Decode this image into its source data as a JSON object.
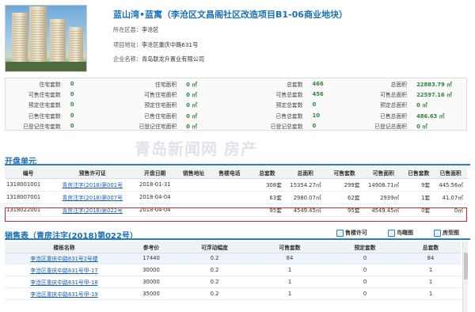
{
  "project": {
    "title": "蓝山湾•蓝寓（李沧区文昌阁社区改造项目B1-06商业地块）",
    "district_label": "所在区县：",
    "district": "李沧区",
    "address_label": "项目地址：",
    "address": "李沧区重庆中路631号",
    "company_label": "企业名称：",
    "company": "青岛联龙升置业有限公司"
  },
  "stats": [
    [
      "住宅套数",
      "0",
      "住宅面积",
      "0 ㎡",
      "总套数",
      "466",
      "总面积",
      "22883.79 ㎡"
    ],
    [
      "可售住宅套数",
      "0",
      "可售住宅面积",
      "0 ㎡",
      "可售总套数",
      "456",
      "可售总面积",
      "22597.16 ㎡"
    ],
    [
      "预定住宅套数",
      "0",
      "预定住宅面积",
      "0 ㎡",
      "预定总套数",
      "0",
      "预定总面积",
      "0 ㎡"
    ],
    [
      "已售住宅套数",
      "0",
      "已售住宅面积",
      "0 ㎡",
      "已售总套数",
      "10",
      "已售总面积",
      "486.63 ㎡"
    ],
    [
      "已登记住宅套数",
      "0",
      "已登记住宅面积",
      "0 ㎡",
      "已登记总套数",
      "0",
      "已登记总面积",
      "0 ㎡"
    ]
  ],
  "watermark": "青岛新闻网 房产",
  "units_section": {
    "title": "开盘单元",
    "headers": [
      "编号",
      "预售许可证",
      "开盘日期",
      "销售地址",
      "售楼电话",
      "总套数",
      "总面积",
      "可售套数",
      "可售面积",
      "已售套数",
      "已售面积"
    ],
    "rows": [
      [
        "1318001001",
        "青房注字(2018)第001号",
        "2018-01-31",
        "",
        "",
        "308套",
        "15354.27㎡",
        "299套",
        "14908.71㎡",
        "9套",
        "445.56㎡"
      ],
      [
        "1318007001",
        "青房注字(2018)第007号",
        "2018-04-04",
        "",
        "",
        "63套",
        "2980.07㎡",
        "62套",
        "2939㎡",
        "1套",
        "41.07㎡"
      ],
      [
        "1318022001",
        "青房注字(2018)第022号",
        "2018-04-04",
        "",
        "",
        "95套",
        "4549.45㎡",
        "95套",
        "4549.45㎡",
        "0套",
        "0㎡"
      ]
    ]
  },
  "sales_section": {
    "title": "销售表（青房注字(2018)第022号）",
    "links": [
      "售楼许可",
      "鸟瞰图",
      "房型图"
    ],
    "headers": [
      "楼栋名称",
      "参考价",
      "可浮动幅度",
      "可售套数",
      "预定套数",
      "总套数"
    ],
    "rows": [
      [
        "李沧区重庆中路631号2号楼",
        "17440",
        "0.2",
        "84",
        "0",
        "84"
      ],
      [
        "李沧区重庆中路631号甲-17",
        "30000",
        "0.2",
        "1",
        "0",
        "1"
      ],
      [
        "李沧区重庆中路631号甲-18",
        "30000",
        "0.2",
        "1",
        "0",
        "1"
      ],
      [
        "李沧区重庆中路631号甲-19",
        "35000",
        "0.2",
        "1",
        "0",
        "1"
      ]
    ]
  }
}
